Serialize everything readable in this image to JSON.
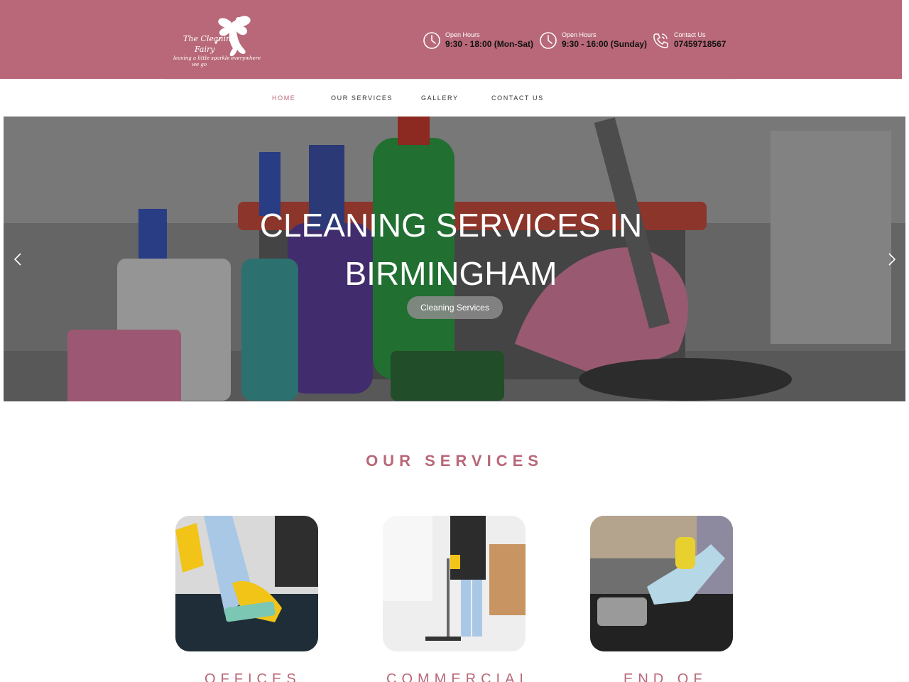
{
  "brand": {
    "line1": "The Cleaning",
    "line2": "Fairy",
    "tagline1": "leaving a little sparkle everywhere",
    "tagline2": "we go",
    "color": "#b86878"
  },
  "header_info": [
    {
      "icon": "clock-icon",
      "label": "Open Hours",
      "value": "9:30 - 18:00 (Mon-Sat)"
    },
    {
      "icon": "clock-icon",
      "label": "Open Hours",
      "value": "9:30 - 16:00 (Sunday)"
    },
    {
      "icon": "phone-icon",
      "label": "Contact Us",
      "value": "07459718567"
    }
  ],
  "nav": {
    "items": [
      "HOME",
      "OUR SERVICES",
      "GALLERY",
      "CONTACT US"
    ],
    "active": "HOME"
  },
  "hero": {
    "title_line1": "CLEANING SERVICES IN",
    "title_line2": "BIRMINGHAM",
    "button": "Cleaning Services"
  },
  "services": {
    "heading": "OUR SERVICES",
    "cards": [
      {
        "label": "OFFICES"
      },
      {
        "label": "COMMERCIAL"
      },
      {
        "label": "END OF"
      }
    ]
  }
}
